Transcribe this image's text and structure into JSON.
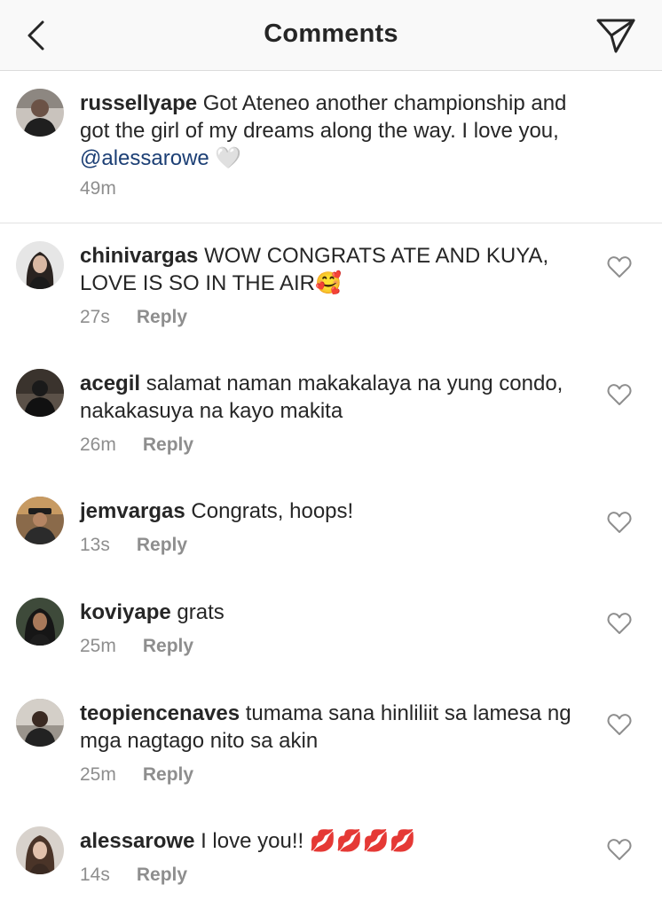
{
  "header": {
    "title": "Comments"
  },
  "caption": {
    "username": "russellyape",
    "text_before": " Got Ateneo another championship and got the girl of my dreams along the way. I love you, ",
    "mention": "@alessarowe",
    "emoji": " 🤍",
    "time": "49m"
  },
  "comments": [
    {
      "username": "chinivargas",
      "text": " WOW CONGRATS ATE AND KUYA, LOVE IS SO IN THE AIR🥰",
      "time": "27s",
      "reply": "Reply"
    },
    {
      "username": "acegil",
      "text": " salamat naman makakalaya na yung condo, nakakasuya na kayo makita",
      "time": "26m",
      "reply": "Reply"
    },
    {
      "username": "jemvargas",
      "text": " Congrats, hoops!",
      "time": "13s",
      "reply": "Reply"
    },
    {
      "username": "koviyape",
      "text": " grats",
      "time": "25m",
      "reply": "Reply"
    },
    {
      "username": "teopiencenaves",
      "text": " tumama sana hinliliit sa lamesa ng mga nagtago nito sa akin",
      "time": "25m",
      "reply": "Reply"
    },
    {
      "username": "alessarowe",
      "text": " I love you!! 💋💋💋💋",
      "time": "14s",
      "reply": "Reply"
    }
  ],
  "colors": {
    "mention": "#1c3f75",
    "meta_gray": "#8e8e8e",
    "text": "#262626"
  },
  "icons": [
    "back-chevron-icon",
    "send-direct-icon",
    "heart-outline-icon"
  ]
}
